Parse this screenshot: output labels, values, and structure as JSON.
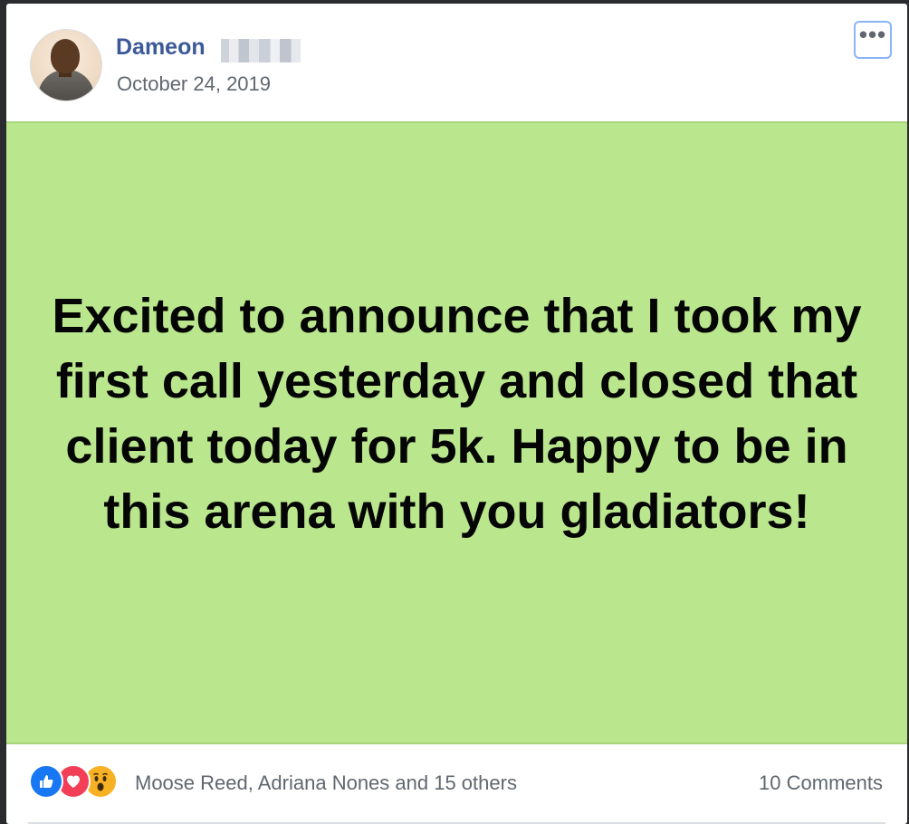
{
  "post": {
    "author": "Dameon",
    "date": "October 24, 2019",
    "text": "Excited to announce that I took my first call yesterday and closed that client today for 5k. Happy to be in this arena with you gladiators!",
    "background_color": "#bae78d"
  },
  "reactions": {
    "icons": [
      "like-icon",
      "love-icon",
      "wow-icon"
    ],
    "names_text": "Moose Reed, Adriana Nones and 15 others"
  },
  "comments": {
    "count_text": "10 Comments"
  },
  "menu": {
    "icon": "more-options-icon",
    "label": "•••"
  },
  "colors": {
    "author_name": "#3b5998",
    "meta_text": "#606770",
    "like": "#1877f2",
    "love": "#f33e58",
    "wow": "#f7b125"
  }
}
